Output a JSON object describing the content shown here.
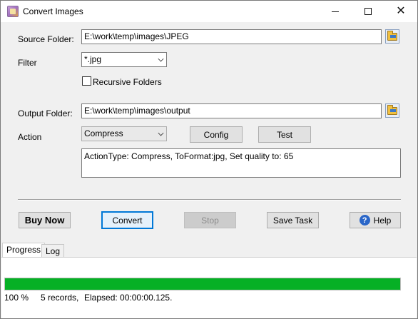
{
  "window": {
    "title": "Convert Images",
    "icon": "app-image-icon"
  },
  "source": {
    "label": "Source Folder:",
    "value": "E:\\work\\temp\\images\\JPEG"
  },
  "filter": {
    "label": "Filter",
    "value": "*.jpg"
  },
  "recursive": {
    "label": "Recursive Folders",
    "checked": false
  },
  "output": {
    "label": "Output Folder:",
    "value": "E:\\work\\temp\\images\\output"
  },
  "action": {
    "label": "Action",
    "value": "Compress",
    "config_label": "Config",
    "test_label": "Test"
  },
  "summary": "ActionType: Compress, ToFormat:jpg, Set quality to: 65",
  "buttons": {
    "buy_now": "Buy Now",
    "convert": "Convert",
    "stop": "Stop",
    "save_task": "Save Task",
    "help": "Help"
  },
  "tabs": [
    {
      "label": "Progress",
      "active": true
    },
    {
      "label": "Log",
      "active": false
    }
  ],
  "progress": {
    "fraction": 1.0,
    "percent_text": "100 %",
    "records_text": "5 records,",
    "elapsed_text": "Elapsed: 00:00:00.125.",
    "color": "#06b025"
  }
}
